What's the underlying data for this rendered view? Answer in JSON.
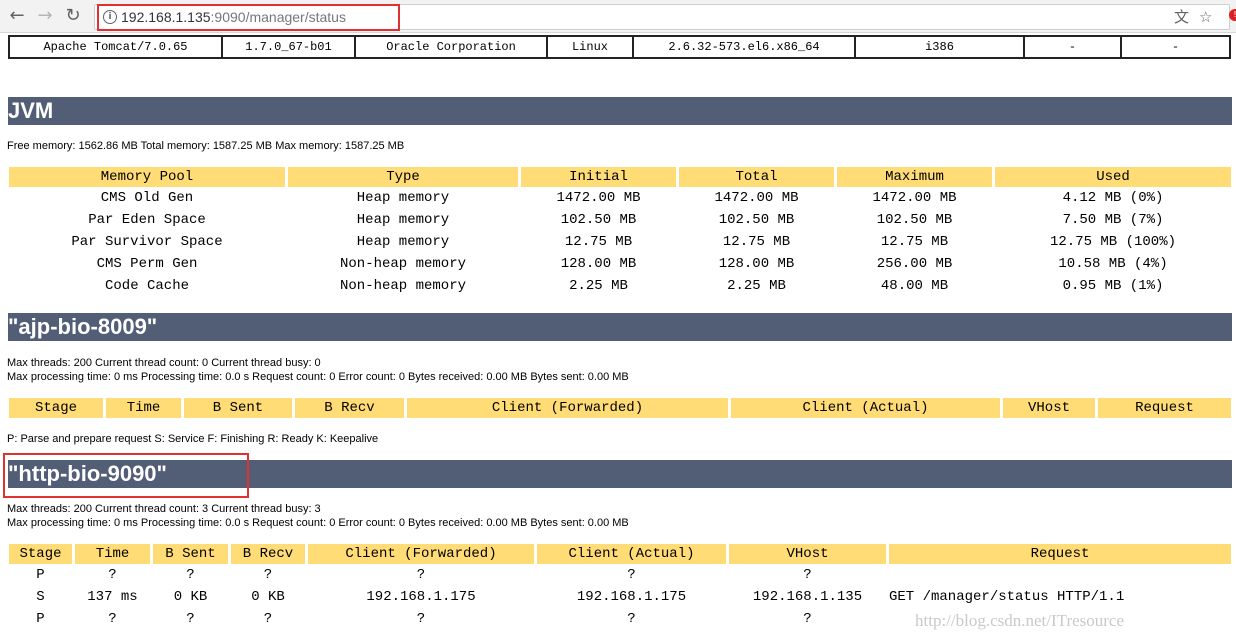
{
  "browser": {
    "url_host": "192.168.1.135",
    "url_rest": ":9090/manager/status",
    "icons": [
      "back-icon",
      "forward-icon",
      "reload-icon",
      "info-icon",
      "translate-icon",
      "star-icon"
    ]
  },
  "server_row": [
    "Apache Tomcat/7.0.65",
    "1.7.0_67-b01",
    "Oracle Corporation",
    "Linux",
    "2.6.32-573.el6.x86_64",
    "i386",
    "-",
    "-"
  ],
  "jvm": {
    "heading": "JVM",
    "memory_line": "Free memory: 1562.86 MB Total memory: 1587.25 MB Max memory: 1587.25 MB",
    "headers": [
      "Memory Pool",
      "Type",
      "Initial",
      "Total",
      "Maximum",
      "Used"
    ],
    "rows": [
      [
        "CMS Old Gen",
        "Heap memory",
        "1472.00 MB",
        "1472.00 MB",
        "1472.00 MB",
        "4.12 MB (0%)"
      ],
      [
        "Par Eden Space",
        "Heap memory",
        "102.50 MB",
        "102.50 MB",
        "102.50 MB",
        "7.50 MB (7%)"
      ],
      [
        "Par Survivor Space",
        "Heap memory",
        "12.75 MB",
        "12.75 MB",
        "12.75 MB",
        "12.75 MB (100%)"
      ],
      [
        "CMS Perm Gen",
        "Non-heap memory",
        "128.00 MB",
        "128.00 MB",
        "256.00 MB",
        "10.58 MB (4%)"
      ],
      [
        "Code Cache",
        "Non-heap memory",
        "2.25 MB",
        "2.25 MB",
        "48.00 MB",
        "0.95 MB (1%)"
      ]
    ]
  },
  "ajp": {
    "heading": "\"ajp-bio-8009\"",
    "line1": "Max threads: 200 Current thread count: 0 Current thread busy: 0",
    "line2": "Max processing time: 0 ms Processing time: 0.0 s Request count: 0 Error count: 0 Bytes received: 0.00 MB Bytes sent: 0.00 MB",
    "headers": [
      "Stage",
      "Time",
      "B Sent",
      "B Recv",
      "Client (Forwarded)",
      "Client (Actual)",
      "VHost",
      "Request"
    ],
    "legend": "P: Parse and prepare request S: Service F: Finishing R: Ready K: Keepalive"
  },
  "http": {
    "heading": "\"http-bio-9090\"",
    "line1": "Max threads: 200 Current thread count: 3 Current thread busy: 3",
    "line2": "Max processing time: 0 ms Processing time: 0.0 s Request count: 0 Error count: 0 Bytes received: 0.00 MB Bytes sent: 0.00 MB",
    "headers": [
      "Stage",
      "Time",
      "B Sent",
      "B Recv",
      "Client (Forwarded)",
      "Client (Actual)",
      "VHost",
      "Request"
    ],
    "rows": [
      [
        "P",
        "?",
        "?",
        "?",
        "?",
        "?",
        "?",
        ""
      ],
      [
        "S",
        "137 ms",
        "0 KB",
        "0 KB",
        "192.168.1.175",
        "192.168.1.175",
        "192.168.1.135",
        "GET /manager/status HTTP/1.1"
      ],
      [
        "P",
        "?",
        "?",
        "?",
        "?",
        "?",
        "?",
        ""
      ]
    ]
  },
  "watermark": "http://blog.csdn.net/ITresource"
}
